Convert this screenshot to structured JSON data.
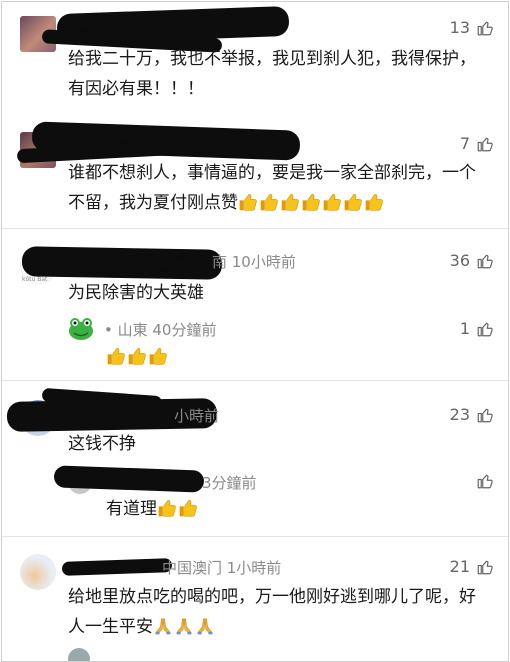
{
  "comments": [
    {
      "likes": "13",
      "text": "给我二十万，我也不举报，我见到刹人犯，我得保护，有因必有果！！！"
    },
    {
      "likes": "7",
      "text": "谁都不想刹人，事情逼的，要是我一家全部刹完，一个不留，我为夏付刚点赞",
      "emoji_count": 7
    },
    {
      "meta": "南 10小時前",
      "likes": "36",
      "text": "为民除害的大英雄",
      "avatar_caption": "kōtu Bāt",
      "reply": {
        "meta": "山東 40分鐘前",
        "likes": "1",
        "emoji_count": 3
      }
    },
    {
      "meta": "小時前",
      "likes": "23",
      "text": "这钱不挣",
      "reply": {
        "meta": "3分鐘前",
        "text": "有道理",
        "emoji_count": 2
      }
    },
    {
      "meta": "中国澳门 1小時前",
      "likes": "21",
      "text": "给地里放点吃的喝的吧，万一他刚好逃到哪儿了呢，好人一生平安",
      "emoji_count": 3
    }
  ],
  "colors": {
    "emoji_yellow": "#f5b800",
    "meta_gray": "#8a8a8a",
    "frog_green": "#3cb043"
  }
}
